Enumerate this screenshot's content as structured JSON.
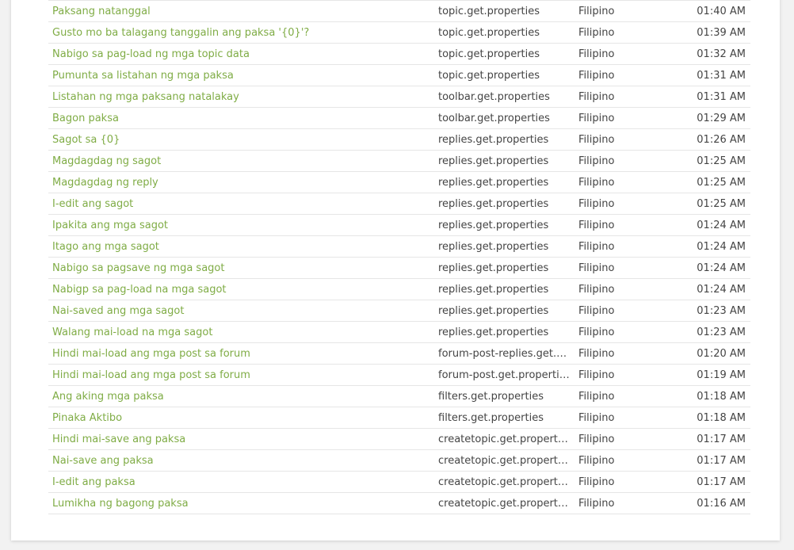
{
  "colors": {
    "link": "#7fac45",
    "text": "#444444",
    "divider": "#e6e6e6",
    "background": "#f2f2f2",
    "card": "#ffffff"
  },
  "rows": [
    {
      "text": "Paksang natanggal",
      "resource": "topic.get.properties",
      "language": "Filipino",
      "time": "01:40 AM"
    },
    {
      "text": "Gusto mo ba talagang tanggalin ang paksa '{0}'?",
      "resource": "topic.get.properties",
      "language": "Filipino",
      "time": "01:39 AM"
    },
    {
      "text": "Nabigo sa pag-load ng mga topic data",
      "resource": "topic.get.properties",
      "language": "Filipino",
      "time": "01:32 AM"
    },
    {
      "text": "Pumunta sa listahan ng mga paksa",
      "resource": "topic.get.properties",
      "language": "Filipino",
      "time": "01:31 AM"
    },
    {
      "text": "Listahan ng mga paksang natalakay",
      "resource": "toolbar.get.properties",
      "language": "Filipino",
      "time": "01:31 AM"
    },
    {
      "text": "Bagon paksa",
      "resource": "toolbar.get.properties",
      "language": "Filipino",
      "time": "01:29 AM"
    },
    {
      "text": "Sagot sa {0}",
      "resource": "replies.get.properties",
      "language": "Filipino",
      "time": "01:26 AM"
    },
    {
      "text": "Magdagdag ng sagot",
      "resource": "replies.get.properties",
      "language": "Filipino",
      "time": "01:25 AM"
    },
    {
      "text": "Magdagdag ng reply",
      "resource": "replies.get.properties",
      "language": "Filipino",
      "time": "01:25 AM"
    },
    {
      "text": "I-edit ang sagot",
      "resource": "replies.get.properties",
      "language": "Filipino",
      "time": "01:25 AM"
    },
    {
      "text": "Ipakita ang mga sagot",
      "resource": "replies.get.properties",
      "language": "Filipino",
      "time": "01:24 AM"
    },
    {
      "text": "Itago ang mga sagot",
      "resource": "replies.get.properties",
      "language": "Filipino",
      "time": "01:24 AM"
    },
    {
      "text": "Nabigo sa pagsave ng mga sagot",
      "resource": "replies.get.properties",
      "language": "Filipino",
      "time": "01:24 AM"
    },
    {
      "text": "Nabigp sa pag-load na mga sagot",
      "resource": "replies.get.properties",
      "language": "Filipino",
      "time": "01:24 AM"
    },
    {
      "text": "Nai-saved ang mga sagot",
      "resource": "replies.get.properties",
      "language": "Filipino",
      "time": "01:23 AM"
    },
    {
      "text": "Walang mai-load na mga sagot",
      "resource": "replies.get.properties",
      "language": "Filipino",
      "time": "01:23 AM"
    },
    {
      "text": "Hindi mai-load ang mga post sa forum",
      "resource": "forum-post-replies.get.properties",
      "language": "Filipino",
      "time": "01:20 AM"
    },
    {
      "text": "Hindi mai-load ang mga post sa forum",
      "resource": "forum-post.get.properties",
      "language": "Filipino",
      "time": "01:19 AM"
    },
    {
      "text": "Ang aking mga paksa",
      "resource": "filters.get.properties",
      "language": "Filipino",
      "time": "01:18 AM"
    },
    {
      "text": "Pinaka Aktibo",
      "resource": "filters.get.properties",
      "language": "Filipino",
      "time": "01:18 AM"
    },
    {
      "text": "Hindi mai-save ang paksa",
      "resource": "createtopic.get.properties",
      "language": "Filipino",
      "time": "01:17 AM"
    },
    {
      "text": "Nai-save ang paksa",
      "resource": "createtopic.get.properties",
      "language": "Filipino",
      "time": "01:17 AM"
    },
    {
      "text": "I-edit ang paksa",
      "resource": "createtopic.get.properties",
      "language": "Filipino",
      "time": "01:17 AM"
    },
    {
      "text": "Lumikha ng bagong paksa",
      "resource": "createtopic.get.properties",
      "language": "Filipino",
      "time": "01:16 AM"
    }
  ]
}
